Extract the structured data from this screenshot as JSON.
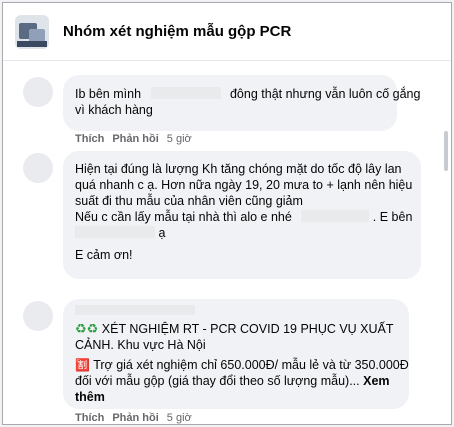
{
  "group": {
    "name": "Nhóm xét nghiệm mẫu gộp PCR"
  },
  "comment1": {
    "line1_before": "Ib bên mình",
    "line1_after": "đông thật nhưng vẫn luôn cố gắng",
    "line2": "vì khách hàng",
    "like_label": "Thích",
    "reply_label": "Phản hồi",
    "time": "5 giờ"
  },
  "comment2": {
    "line1": "Hiện tại đúng là lượng Kh tăng chóng mặt do tốc độ lây lan",
    "line2": "quá nhanh c ạ. Hơn nữa ngày 19, 20 mưa to + lạnh nên hiệu",
    "line3": "suất đi thu mẫu của nhân viên cũng giảm",
    "line4_before": "Nếu c cần lấy mẫu tại nhà thì alo e nhé",
    "line4_after": ". E bên",
    "line5_after": "ạ",
    "line6": "E cảm ơn!"
  },
  "comment3": {
    "icons": "♻♻",
    "line1": "XÉT NGHIỆM RT - PCR COVID 19 PHỤC VỤ XUẤT",
    "line2": "CẢNH. Khu vực Hà Nội",
    "fire_icon": "🈹",
    "line3": "Trợ giá xét nghiệm chỉ 650.000Đ/ mẫu lẻ và từ 350.000Đ",
    "line4": "đối với mẫu gộp (giá thay đổi theo số lượng mẫu)...",
    "see_more_a": "Xem",
    "see_more_b": "thêm",
    "like_label": "Thích",
    "reply_label": "Phản hồi",
    "time": "5 giờ"
  }
}
